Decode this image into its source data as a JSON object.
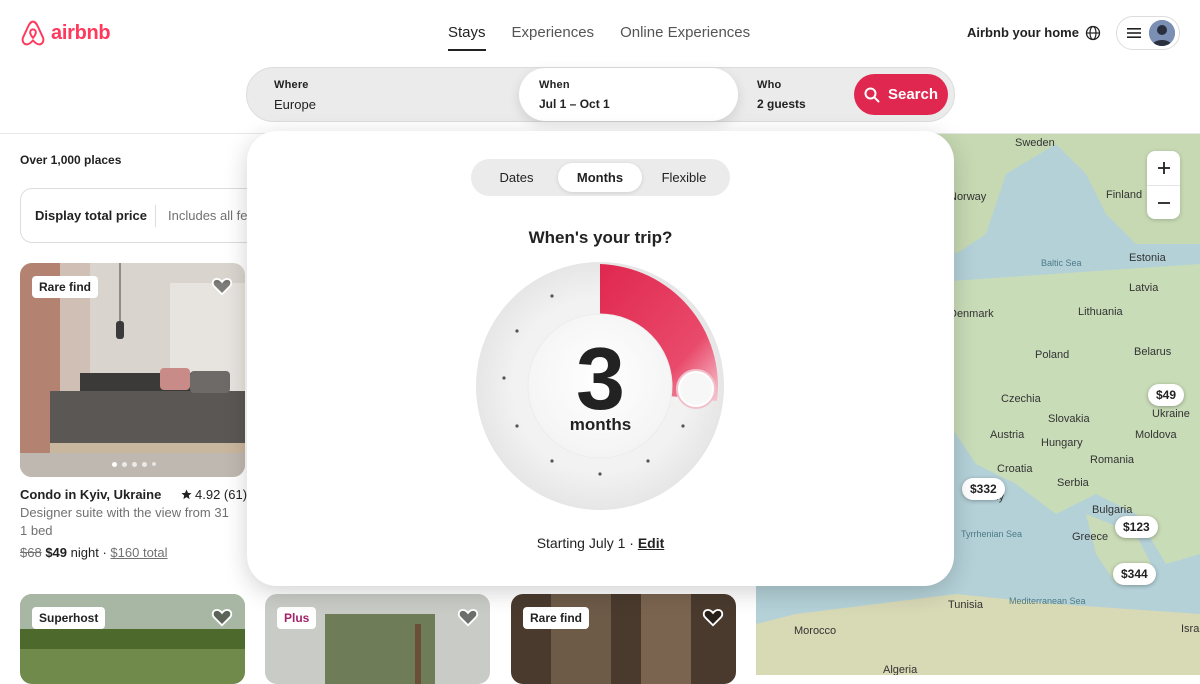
{
  "header": {
    "logo_text": "airbnb",
    "tabs": [
      {
        "label": "Stays",
        "active": true
      },
      {
        "label": "Experiences",
        "active": false
      },
      {
        "label": "Online Experiences",
        "active": false
      }
    ],
    "host_link": "Airbnb your home",
    "brand_color": "#ff385c"
  },
  "search": {
    "where_label": "Where",
    "where_value": "Europe",
    "when_label": "When",
    "when_value": "Jul 1 – Oct 1",
    "who_label": "Who",
    "who_value": "2 guests",
    "button_label": "Search"
  },
  "results": {
    "count_text": "Over 1,000 places",
    "price_toggle_label": "Display total price",
    "price_toggle_sub": "Includes all fees"
  },
  "listing": {
    "badge": "Rare find",
    "title": "Condo in Kyiv, Ukraine",
    "rating": "4.92 (61)",
    "description": "Designer suite with the view from 31",
    "beds": "1 bed",
    "old_price": "$68",
    "price": "$49",
    "per": "night ·",
    "total": "$160 total"
  },
  "bottom_cards": [
    {
      "badge": "Superhost"
    },
    {
      "badge": "Plus"
    },
    {
      "badge": "Rare find"
    }
  ],
  "map": {
    "countries": [
      "Sweden",
      "Finland",
      "Norway",
      "Estonia",
      "Latvia",
      "Baltic Sea",
      "Denmark",
      "Lithuania",
      "Belarus",
      "Poland",
      "Czechia",
      "Ukraine",
      "Slovakia",
      "Austria",
      "Hungary",
      "Moldova",
      "Romania",
      "Croatia",
      "Serbia",
      "Italy",
      "Bulgaria",
      "Tyrrhenian Sea",
      "Greece",
      "Tunisia",
      "Mediterranean Sea",
      "Morocco",
      "Algeria",
      "Isra"
    ],
    "pins": [
      "$49",
      "$332",
      "$123",
      "$344"
    ]
  },
  "modal": {
    "tabs": [
      "Dates",
      "Months",
      "Flexible"
    ],
    "active_tab": "Months",
    "question": "When's your trip?",
    "months_value": "3",
    "unit": "months",
    "starting_text": "Starting July 1 ·",
    "edit_label": "Edit"
  }
}
